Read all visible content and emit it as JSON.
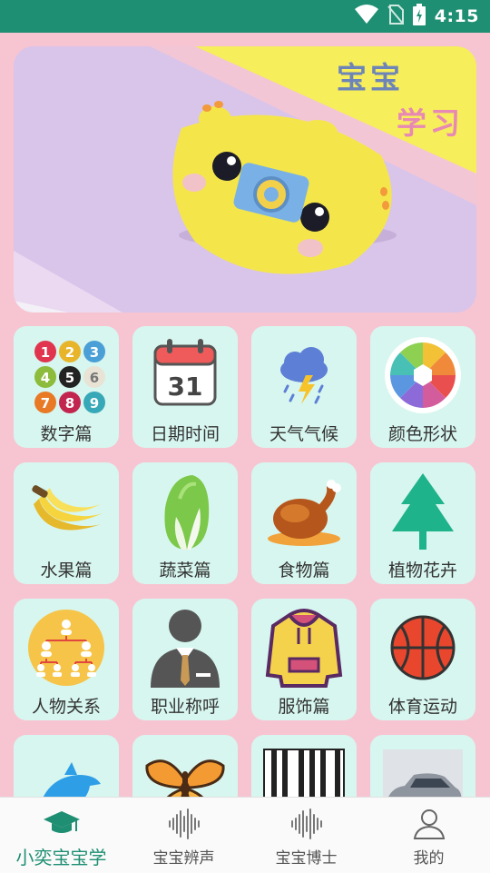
{
  "status_bar": {
    "time": "4:15",
    "icons": [
      "wifi-icon",
      "no-sim-icon",
      "battery-charging-icon"
    ]
  },
  "banner": {
    "title_line1": "宝宝",
    "title_line2": "学习"
  },
  "categories": [
    {
      "label": "数字篇",
      "icon": "numbers-icon"
    },
    {
      "label": "日期时间",
      "icon": "calendar-icon"
    },
    {
      "label": "天气气候",
      "icon": "weather-icon"
    },
    {
      "label": "颜色形状",
      "icon": "color-wheel-icon"
    },
    {
      "label": "水果篇",
      "icon": "banana-icon"
    },
    {
      "label": "蔬菜篇",
      "icon": "cabbage-icon"
    },
    {
      "label": "食物篇",
      "icon": "roast-chicken-icon"
    },
    {
      "label": "植物花卉",
      "icon": "tree-icon"
    },
    {
      "label": "人物关系",
      "icon": "org-chart-icon"
    },
    {
      "label": "职业称呼",
      "icon": "businessman-icon"
    },
    {
      "label": "服饰篇",
      "icon": "hoodie-icon"
    },
    {
      "label": "体育运动",
      "icon": "basketball-icon"
    },
    {
      "label": "",
      "icon": "dolphin-icon"
    },
    {
      "label": "",
      "icon": "butterfly-icon"
    },
    {
      "label": "",
      "icon": "piano-keys-icon"
    },
    {
      "label": "",
      "icon": "car-icon"
    }
  ],
  "bottom_nav": [
    {
      "label": "小奕宝宝学",
      "icon": "graduation-cap-icon",
      "active": true
    },
    {
      "label": "宝宝辨声",
      "icon": "sound-wave-icon",
      "active": false
    },
    {
      "label": "宝宝博士",
      "icon": "sound-wave-icon",
      "active": false
    },
    {
      "label": "我的",
      "icon": "user-icon",
      "active": false
    }
  ],
  "colors": {
    "accent": "#1f8f73",
    "background": "#f7c5d2",
    "tile": "#d7f6ef"
  }
}
